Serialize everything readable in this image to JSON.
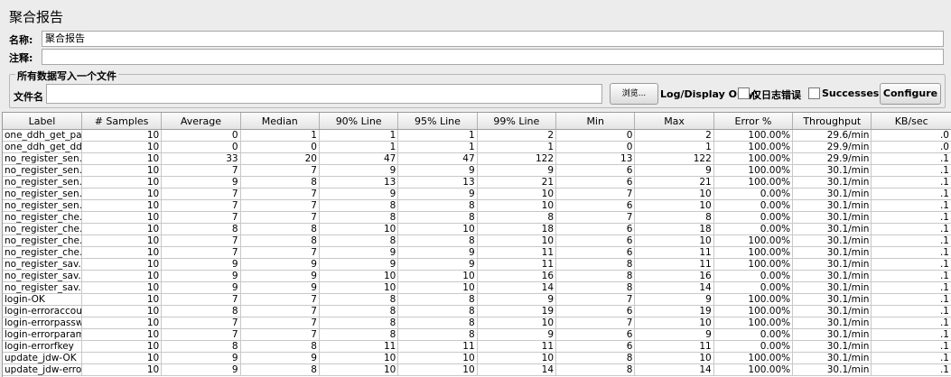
{
  "header": {
    "title": "聚合报告"
  },
  "form": {
    "name_label": "名称:",
    "name_value": "聚合报告",
    "comment_label": "注释:",
    "comment_value": ""
  },
  "file_section": {
    "legend": "所有数据写入一个文件",
    "filename_label": "文件名",
    "filename_value": "",
    "browse_label": "浏览...",
    "log_display_label": "Log/Display Only:",
    "errors_only_label": "仅日志错误",
    "successes_label": "Successes",
    "configure_label": "Configure"
  },
  "table": {
    "columns": [
      "Label",
      "# Samples",
      "Average",
      "Median",
      "90% Line",
      "95% Line",
      "99% Line",
      "Min",
      "Max",
      "Error %",
      "Throughput",
      "KB/sec"
    ],
    "rows": [
      [
        "one_ddh_get_pa...",
        "10",
        "0",
        "1",
        "1",
        "1",
        "2",
        "0",
        "2",
        "100.00%",
        "29.6/min",
        ".0"
      ],
      [
        "one_ddh_get_dd...",
        "10",
        "0",
        "0",
        "1",
        "1",
        "1",
        "0",
        "1",
        "100.00%",
        "29.9/min",
        ".0"
      ],
      [
        "no_register_sen...",
        "10",
        "33",
        "20",
        "47",
        "47",
        "122",
        "13",
        "122",
        "100.00%",
        "29.9/min",
        ".1"
      ],
      [
        "no_register_sen...",
        "10",
        "7",
        "7",
        "9",
        "9",
        "9",
        "6",
        "9",
        "100.00%",
        "30.1/min",
        ".1"
      ],
      [
        "no_register_sen...",
        "10",
        "9",
        "8",
        "13",
        "13",
        "21",
        "6",
        "21",
        "100.00%",
        "30.1/min",
        ".1"
      ],
      [
        "no_register_sen...",
        "10",
        "7",
        "7",
        "9",
        "9",
        "10",
        "7",
        "10",
        "0.00%",
        "30.1/min",
        ".1"
      ],
      [
        "no_register_sen...",
        "10",
        "7",
        "7",
        "8",
        "8",
        "10",
        "6",
        "10",
        "0.00%",
        "30.1/min",
        ".1"
      ],
      [
        "no_register_che...",
        "10",
        "7",
        "7",
        "8",
        "8",
        "8",
        "7",
        "8",
        "0.00%",
        "30.1/min",
        ".1"
      ],
      [
        "no_register_che...",
        "10",
        "8",
        "8",
        "10",
        "10",
        "18",
        "6",
        "18",
        "0.00%",
        "30.1/min",
        ".1"
      ],
      [
        "no_register_che...",
        "10",
        "7",
        "8",
        "8",
        "8",
        "10",
        "6",
        "10",
        "100.00%",
        "30.1/min",
        ".1"
      ],
      [
        "no_register_che...",
        "10",
        "7",
        "7",
        "9",
        "9",
        "11",
        "6",
        "11",
        "100.00%",
        "30.1/min",
        ".1"
      ],
      [
        "no_register_sav...",
        "10",
        "9",
        "9",
        "9",
        "9",
        "11",
        "8",
        "11",
        "100.00%",
        "30.1/min",
        ".1"
      ],
      [
        "no_register_sav...",
        "10",
        "9",
        "9",
        "10",
        "10",
        "16",
        "8",
        "16",
        "0.00%",
        "30.1/min",
        ".1"
      ],
      [
        "no_register_sav...",
        "10",
        "9",
        "9",
        "10",
        "10",
        "14",
        "8",
        "14",
        "0.00%",
        "30.1/min",
        ".1"
      ],
      [
        "login-OK",
        "10",
        "7",
        "7",
        "8",
        "8",
        "9",
        "7",
        "9",
        "100.00%",
        "30.1/min",
        ".1"
      ],
      [
        "login-erroraccount",
        "10",
        "8",
        "7",
        "8",
        "8",
        "19",
        "6",
        "19",
        "100.00%",
        "30.1/min",
        ".1"
      ],
      [
        "login-errorpassw...",
        "10",
        "7",
        "7",
        "8",
        "8",
        "10",
        "7",
        "10",
        "100.00%",
        "30.1/min",
        ".1"
      ],
      [
        "login-errorparama",
        "10",
        "7",
        "7",
        "8",
        "8",
        "9",
        "6",
        "9",
        "0.00%",
        "30.1/min",
        ".1"
      ],
      [
        "login-errorfkey",
        "10",
        "8",
        "8",
        "11",
        "11",
        "11",
        "6",
        "11",
        "0.00%",
        "30.1/min",
        ".1"
      ],
      [
        "update_jdw-OK",
        "10",
        "9",
        "9",
        "10",
        "10",
        "10",
        "8",
        "10",
        "100.00%",
        "30.1/min",
        ".1"
      ],
      [
        "update_jdw-error...",
        "10",
        "9",
        "8",
        "10",
        "10",
        "14",
        "8",
        "14",
        "100.00%",
        "30.1/min",
        ".1"
      ]
    ]
  }
}
